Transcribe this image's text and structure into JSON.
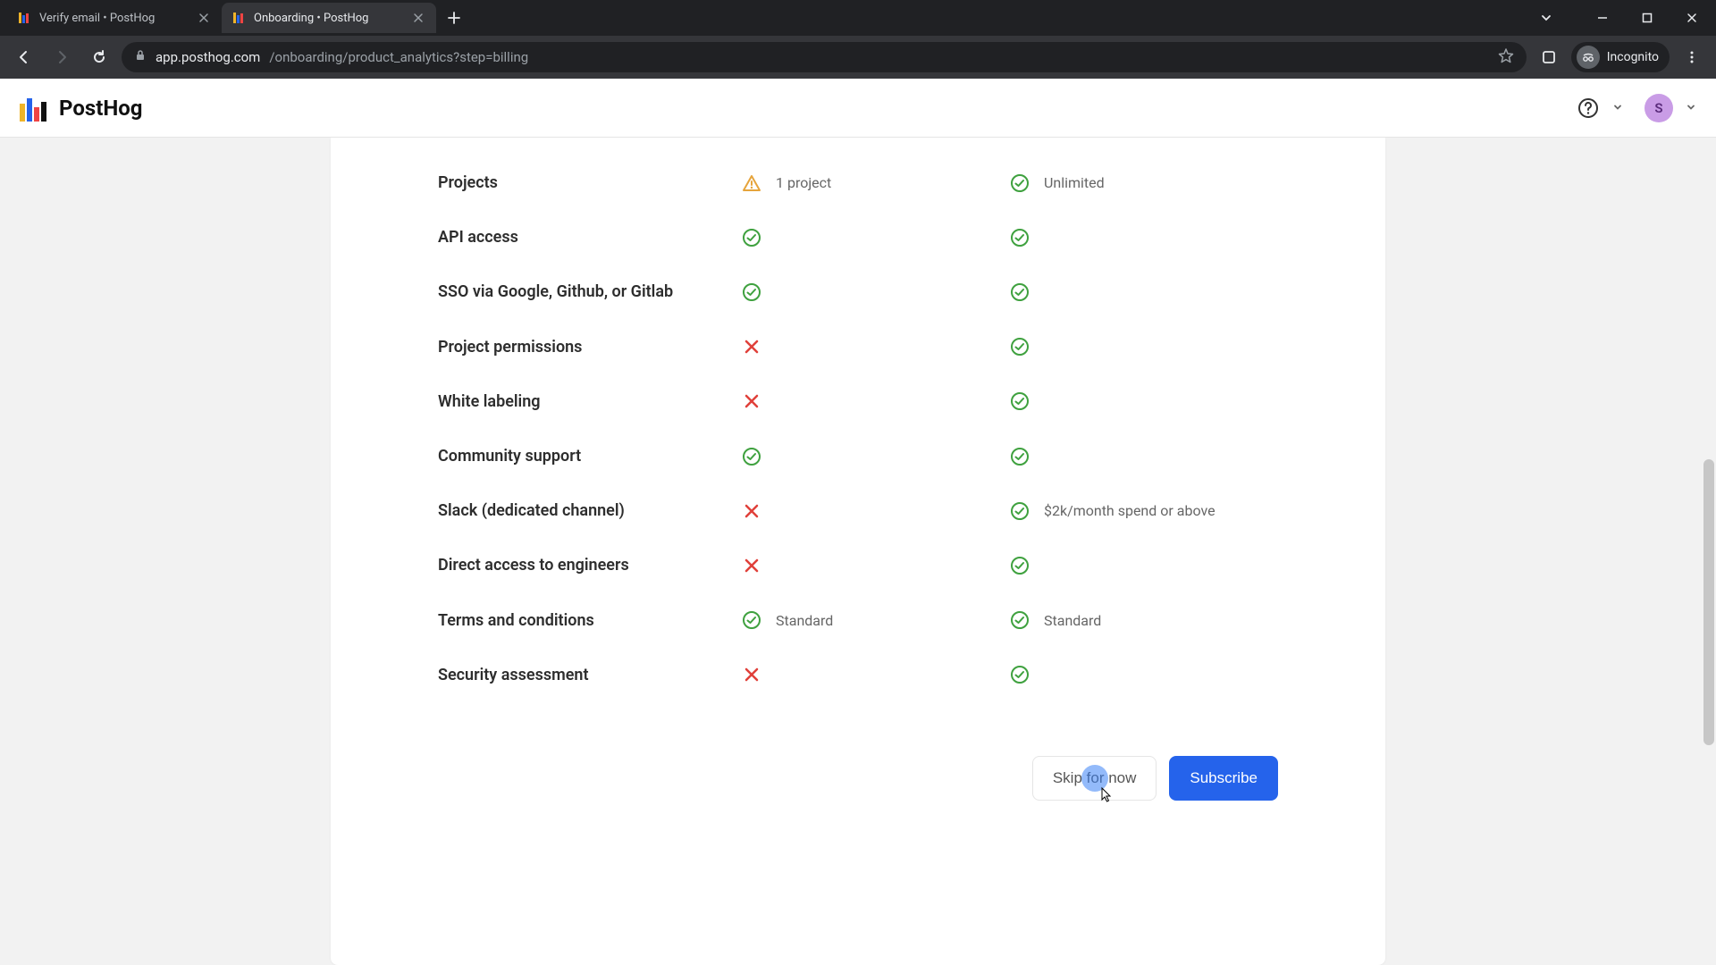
{
  "browser": {
    "tabs": [
      {
        "title": "Verify email • PostHog"
      },
      {
        "title": "Onboarding • PostHog"
      }
    ],
    "url_host": "app.posthog.com",
    "url_path": "/onboarding/product_analytics?step=billing",
    "incognito_label": "Incognito"
  },
  "header": {
    "logo_text": "PostHog",
    "avatar_initial": "S"
  },
  "features": [
    {
      "name": "Projects",
      "col1": {
        "icon": "warn",
        "note": "1 project"
      },
      "col2": {
        "icon": "check",
        "note": "Unlimited"
      }
    },
    {
      "name": "API access",
      "col1": {
        "icon": "check",
        "note": ""
      },
      "col2": {
        "icon": "check",
        "note": ""
      }
    },
    {
      "name": "SSO via Google, Github, or Gitlab",
      "col1": {
        "icon": "check",
        "note": ""
      },
      "col2": {
        "icon": "check",
        "note": ""
      }
    },
    {
      "name": "Project permissions",
      "col1": {
        "icon": "cross",
        "note": ""
      },
      "col2": {
        "icon": "check",
        "note": ""
      }
    },
    {
      "name": "White labeling",
      "col1": {
        "icon": "cross",
        "note": ""
      },
      "col2": {
        "icon": "check",
        "note": ""
      }
    },
    {
      "name": "Community support",
      "col1": {
        "icon": "check",
        "note": ""
      },
      "col2": {
        "icon": "check",
        "note": ""
      }
    },
    {
      "name": "Slack (dedicated channel)",
      "col1": {
        "icon": "cross",
        "note": ""
      },
      "col2": {
        "icon": "check",
        "note": "$2k/month spend or above"
      }
    },
    {
      "name": "Direct access to engineers",
      "col1": {
        "icon": "cross",
        "note": ""
      },
      "col2": {
        "icon": "check",
        "note": ""
      }
    },
    {
      "name": "Terms and conditions",
      "col1": {
        "icon": "check",
        "note": "Standard"
      },
      "col2": {
        "icon": "check",
        "note": "Standard"
      }
    },
    {
      "name": "Security assessment",
      "col1": {
        "icon": "cross",
        "note": ""
      },
      "col2": {
        "icon": "check",
        "note": ""
      }
    }
  ],
  "actions": {
    "skip_label": "Skip for now",
    "subscribe_label": "Subscribe"
  }
}
